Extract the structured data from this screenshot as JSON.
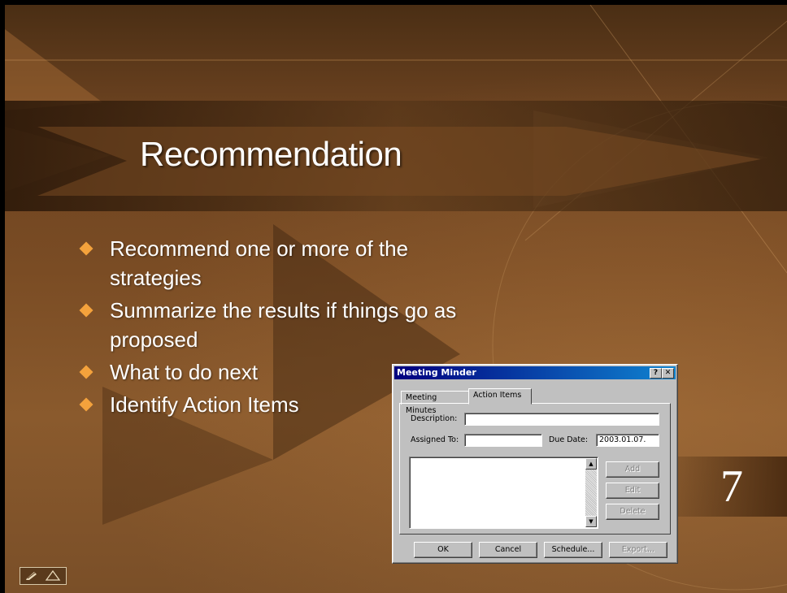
{
  "slide": {
    "title": "Recommendation",
    "bullets": [
      "Recommend one or more of the strategies",
      "Summarize the results if things go as proposed",
      "What to do next",
      "Identify Action Items"
    ],
    "page_number": "7",
    "accent_color": "#f4a23c"
  },
  "dialog": {
    "title": "Meeting Minder",
    "help_button": "?",
    "close_button": "✕",
    "tabs": [
      "Meeting Minutes",
      "Action Items"
    ],
    "active_tab": "Action Items",
    "description_label": "Description:",
    "description_value": "",
    "assigned_to_label": "Assigned To:",
    "assigned_to_value": "",
    "due_date_label": "Due Date:",
    "due_date_value": "2003.01.07.",
    "side_buttons": [
      "Add",
      "Edit",
      "Delete"
    ],
    "bottom_buttons": [
      "OK",
      "Cancel",
      "Schedule...",
      "Export..."
    ]
  }
}
